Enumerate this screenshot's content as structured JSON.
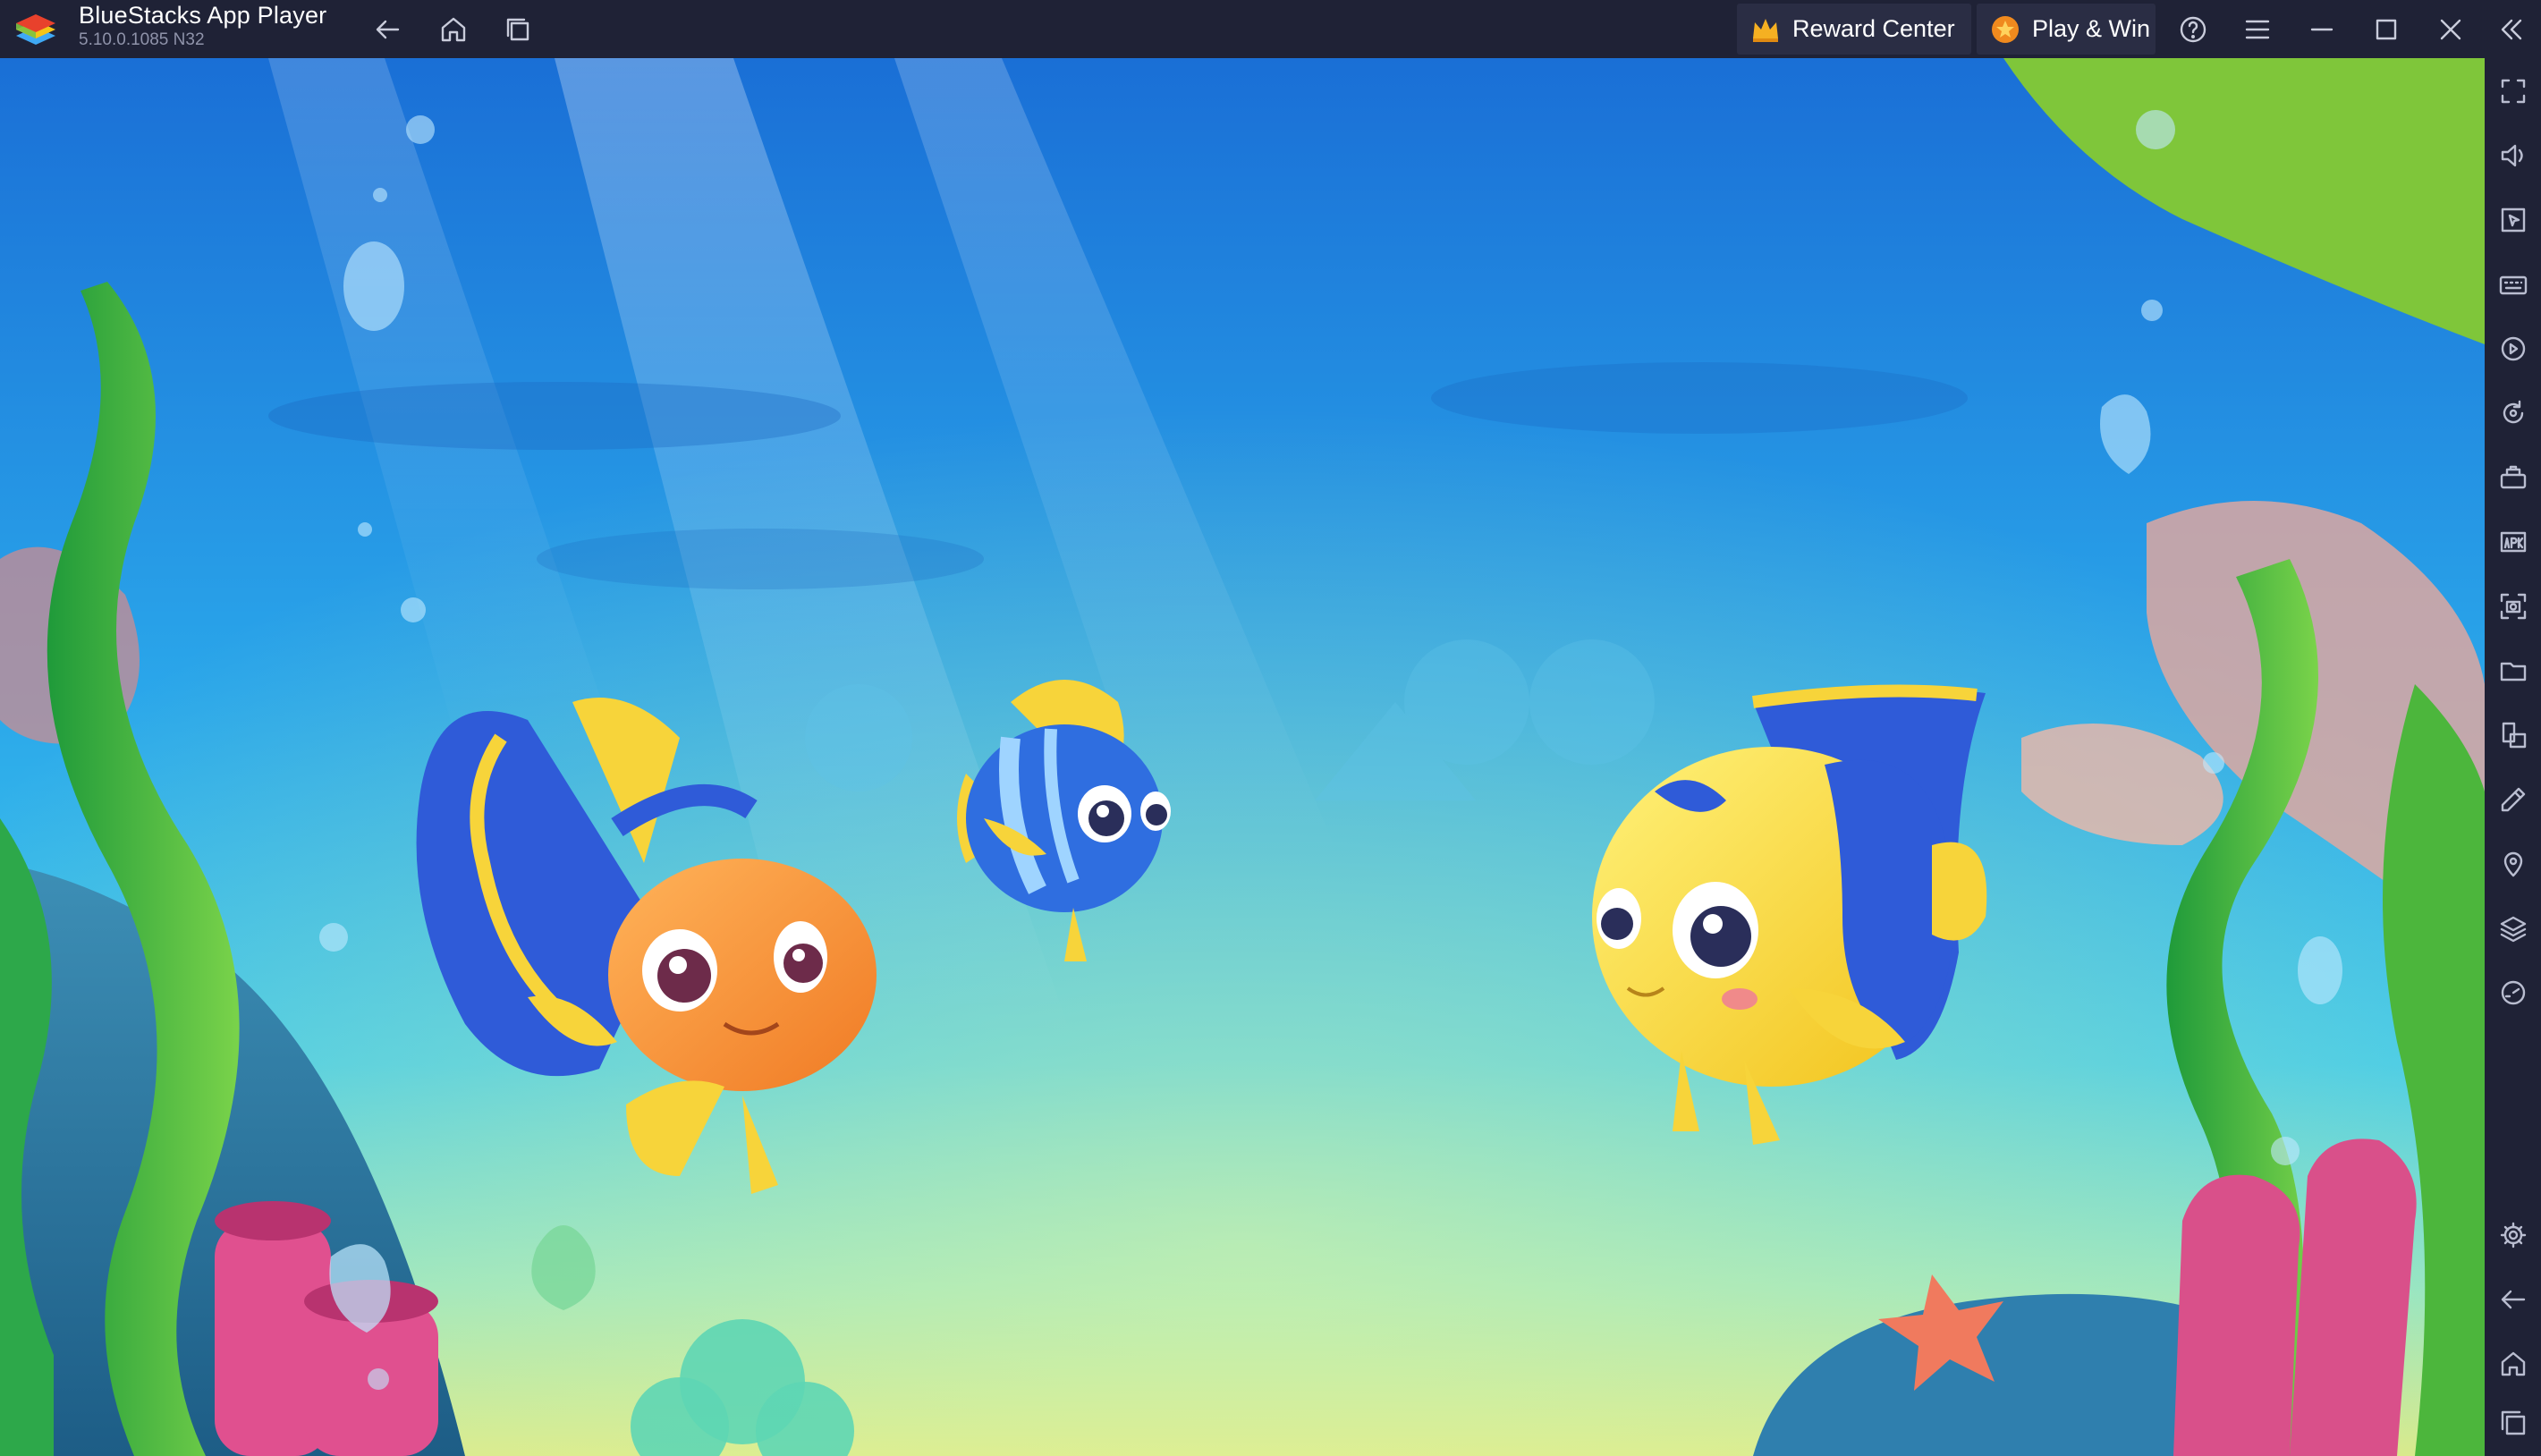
{
  "window": {
    "app_name": "BlueStacks App Player",
    "version": "5.10.0.1085  N32"
  },
  "titlebar": {
    "reward_center_label": "Reward Center",
    "play_win_label": "Play & Win",
    "icons": [
      "back-icon",
      "home-icon",
      "recent-apps-icon",
      "help-icon",
      "menu-icon",
      "minimize-icon",
      "maximize-icon",
      "close-icon",
      "collapse-sidebar-icon"
    ]
  },
  "sidebar": {
    "top_icons": [
      "fullscreen-icon",
      "volume-icon",
      "pointer-icon",
      "keyboard-icon",
      "macro-icon",
      "rotate-icon",
      "game-controls-icon",
      "apk-icon",
      "screenshot-icon",
      "folder-icon",
      "multi-instance-icon",
      "eco-mode-icon",
      "location-icon",
      "layers-icon",
      "performance-icon"
    ],
    "bottom_icons": [
      "settings-icon",
      "android-back-icon",
      "android-home-icon",
      "android-recents-icon"
    ]
  },
  "colors": {
    "chrome_bg": "#1f2236",
    "pill_bg": "#2a2d44",
    "water_top": "#1d76d8",
    "water_mid": "#2fb4ee",
    "water_bottom": "#7de0c8",
    "crown": "#f5b022",
    "coin": "#f08a1e"
  }
}
